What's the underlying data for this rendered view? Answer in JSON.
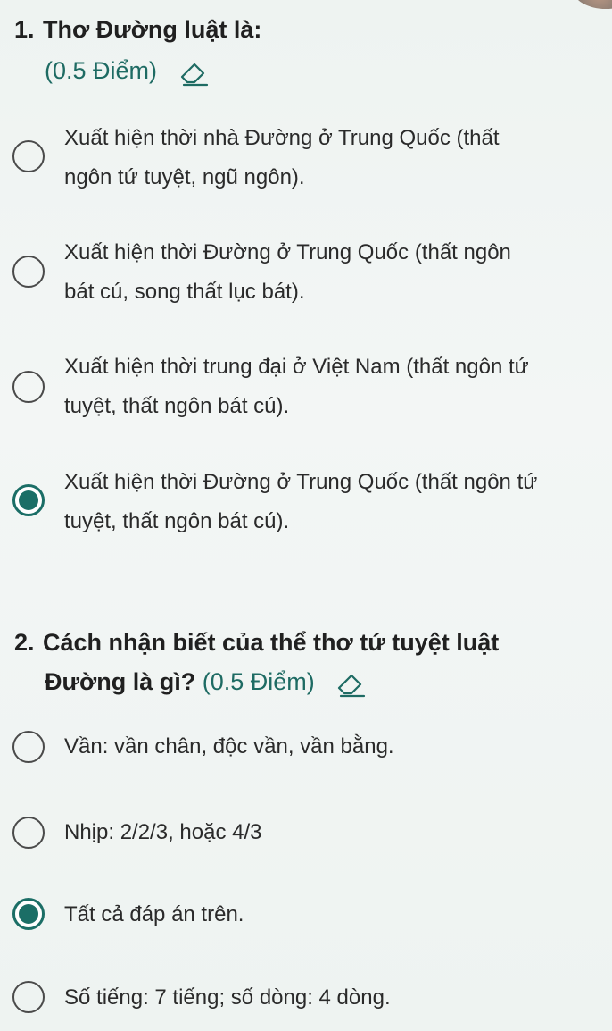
{
  "questions": [
    {
      "number": "1.",
      "title": "Thơ Đường luật là:",
      "points": "(0.5 Điểm)",
      "options": [
        {
          "line1": "Xuất hiện thời nhà Đường ở Trung Quốc (thất",
          "line2": "ngôn tứ tuyệt, ngũ ngôn).",
          "selected": false
        },
        {
          "line1": "Xuất hiện thời Đường ở Trung Quốc (thất ngôn",
          "line2": "bát cú, song thất lục bát).",
          "selected": false
        },
        {
          "line1": "Xuất hiện thời trung đại ở Việt Nam (thất ngôn tứ",
          "line2": "tuyệt, thất ngôn bát cú).",
          "selected": false
        },
        {
          "line1": "Xuất hiện thời Đường ở Trung Quốc (thất ngôn tứ",
          "line2": "tuyệt, thất ngôn bát cú).",
          "selected": true
        }
      ]
    },
    {
      "number": "2.",
      "title_line1": "Cách nhận biết của thể thơ tứ tuyệt luật",
      "title_line2": "Đường là gì?",
      "points": "(0.5 Điểm)",
      "options": [
        {
          "text": "Vần: vần chân, độc vần, vần bằng.",
          "selected": false
        },
        {
          "text": "Nhịp: 2/2/3, hoặc 4/3",
          "selected": false
        },
        {
          "text": "Tất cả đáp án trên.",
          "selected": true
        },
        {
          "text": "Số tiếng: 7 tiếng; số dòng: 4 dòng.",
          "selected": false
        }
      ]
    }
  ],
  "colors": {
    "accent": "#1b6e66",
    "background": "#eef3f1",
    "text": "#2a2a2a"
  },
  "icons": {
    "clear": "eraser-icon",
    "radio_selected": "radio-selected",
    "radio_empty": "radio-empty"
  }
}
